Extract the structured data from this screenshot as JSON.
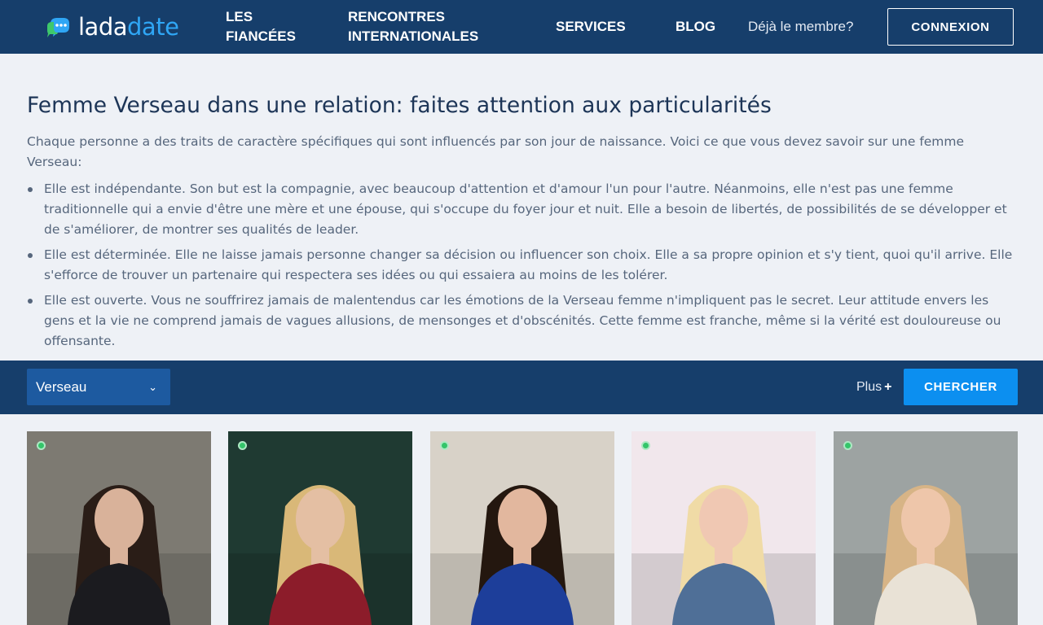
{
  "header": {
    "logo": {
      "part1": "lada",
      "part2": "date",
      "icon": "chat-bubble-icon"
    },
    "nav": [
      {
        "label": "LES FIANCÉES"
      },
      {
        "label": "RENCONTRES INTERNATIONALES"
      },
      {
        "label": "SERVICES"
      },
      {
        "label": "BLOG"
      }
    ],
    "member_text": "Déjà le membre?",
    "login_label": "CONNEXION"
  },
  "article": {
    "title": "Femme Verseau dans une relation: faites attention aux particularités",
    "intro": "Chaque personne a des traits de caractère spécifiques qui sont influencés par son jour de naissance. Voici ce que vous devez savoir sur une femme Verseau:",
    "bullets": [
      "Elle est indépendante. Son but est la compagnie, avec beaucoup d'attention et d'amour l'un pour l'autre. Néanmoins, elle n'est pas une femme traditionnelle qui a envie d'être une mère et une épouse, qui s'occupe du foyer jour et nuit. Elle a besoin de libertés, de possibilités de se développer et de s'améliorer, de montrer ses qualités de leader.",
      "Elle est déterminée. Elle ne laisse jamais personne changer sa décision ou influencer son choix. Elle a sa propre opinion et s'y tient, quoi qu'il arrive. Elle s'efforce de trouver un partenaire qui respectera ses idées ou qui essaiera au moins de les tolérer.",
      "Elle est ouverte. Vous ne souffrirez jamais de malentendus car les émotions de la Verseau femme n'impliquent pas le secret. Leur attitude envers les gens et la vie ne comprend jamais de vagues allusions, de mensonges et d'obscénités. Cette femme est franche, même si la vérité est douloureuse ou offensante."
    ]
  },
  "filter": {
    "sign_selected": "Verseau",
    "more_label": "Plus",
    "more_icon": "+",
    "search_label": "CHERCHER"
  },
  "profiles": [
    {
      "online": true,
      "bg": "#7d7a72",
      "hair": "#2a1d17",
      "outfit": "#1b1b1f",
      "skin": "#d9b29a"
    },
    {
      "online": true,
      "bg": "#1f3a32",
      "hair": "#d9b878",
      "outfit": "#8c1c2a",
      "skin": "#e4bfa3"
    },
    {
      "online": true,
      "bg": "#d8d2c8",
      "hair": "#24170f",
      "outfit": "#1d3e9a",
      "skin": "#e2b79e"
    },
    {
      "online": true,
      "bg": "#f1e7ec",
      "hair": "#f0dba6",
      "outfit": "#4f6f97",
      "skin": "#f0c8b3"
    },
    {
      "online": true,
      "bg": "#9da3a2",
      "hair": "#d7b486",
      "outfit": "#e9e2d6",
      "skin": "#eec6aa"
    }
  ]
}
